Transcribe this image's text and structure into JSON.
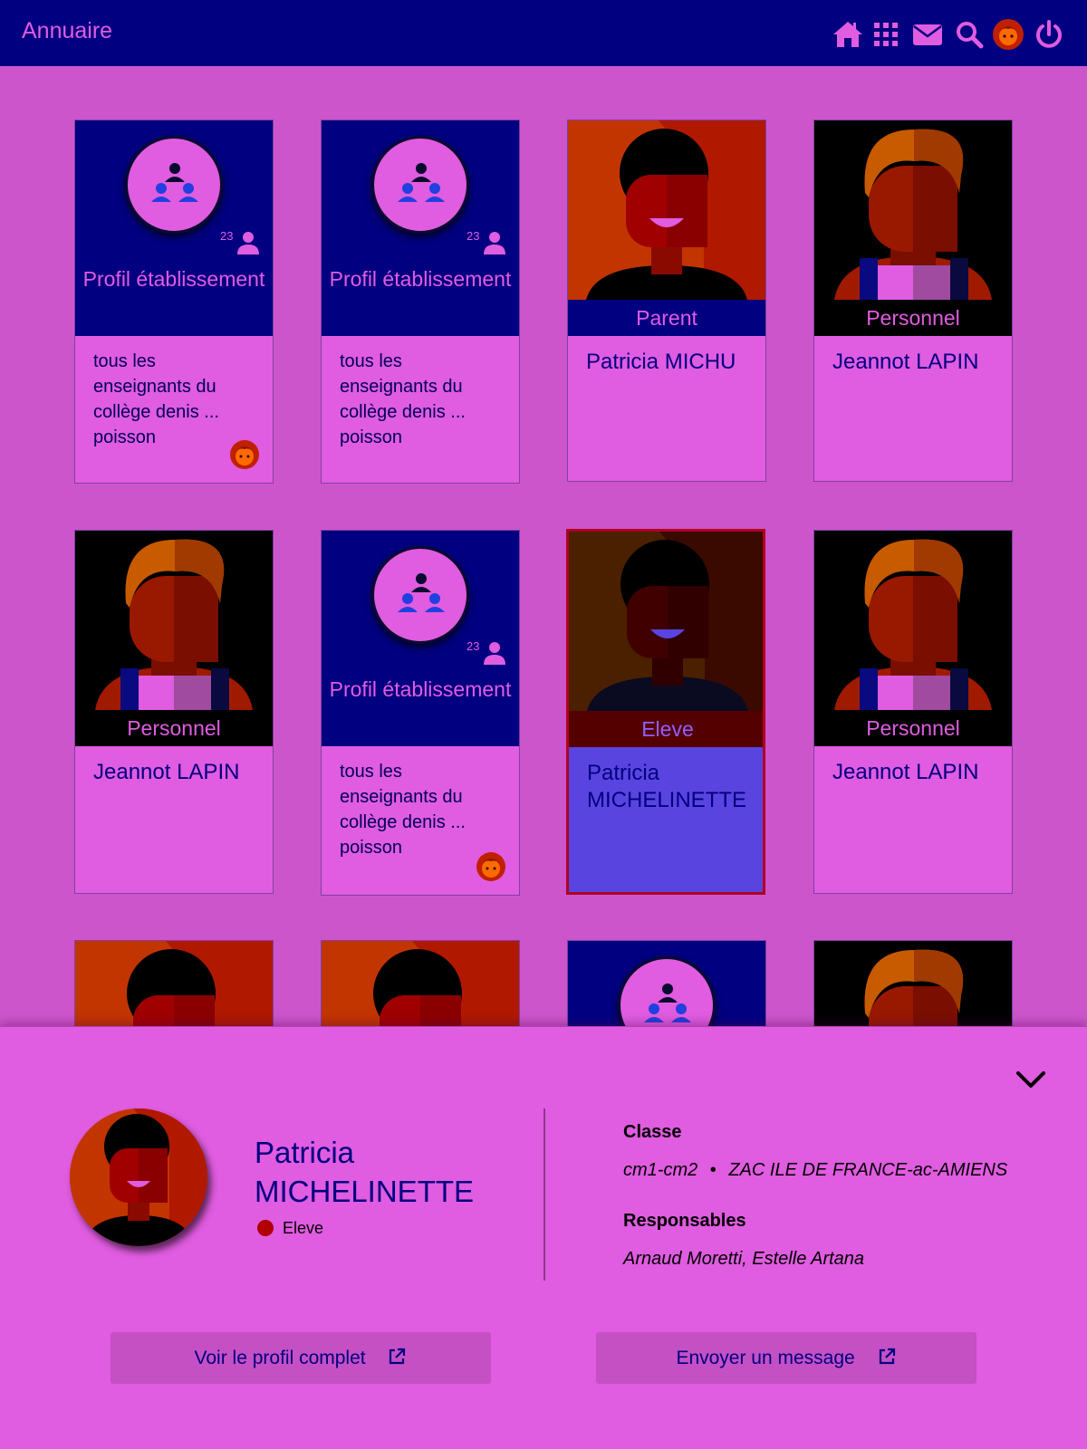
{
  "header": {
    "title": "Annuaire",
    "icons": [
      "home-icon",
      "apps-icon",
      "mail-icon",
      "search-icon",
      "user-avatar-icon",
      "power-icon"
    ]
  },
  "colors": {
    "accent": "#000080",
    "background": "#cc55cc",
    "card": "#e05ce0",
    "selected": "#5a44e0"
  },
  "cards": [
    {
      "kind": "group",
      "label": "Profil établissement",
      "count": "23",
      "description": "tous les enseignants du collège denis ... poisson"
    },
    {
      "kind": "group",
      "label": "Profil établissement",
      "count": "23",
      "description": "tous les enseignants du collège denis ... poisson"
    },
    {
      "kind": "person",
      "type": "Parent",
      "name": "Patricia MICHU"
    },
    {
      "kind": "person",
      "type": "Personnel",
      "name": "Jeannot LAPIN"
    },
    {
      "kind": "person",
      "type": "Personnel",
      "name": "Jeannot LAPIN"
    },
    {
      "kind": "group",
      "label": "Profil établissement",
      "count": "23",
      "description": "tous les enseignants du collège denis ... poisson"
    },
    {
      "kind": "person",
      "type": "Eleve",
      "name": "Patricia MICHELINETTE",
      "selected": true
    },
    {
      "kind": "person",
      "type": "Personnel",
      "name": "Jeannot LAPIN"
    }
  ],
  "panel": {
    "name": "Patricia MICHELINETTE",
    "type": "Eleve",
    "classe_label": "Classe",
    "classe_value": "cm1-cm2",
    "school": "ZAC ILE DE FRANCE-ac-AMIENS",
    "separator": "•",
    "responsables_label": "Responsables",
    "responsables_value": "Arnaud Moretti, Estelle Artana",
    "btn_profile": "Voir le profil complet",
    "btn_message": "Envoyer un message"
  }
}
